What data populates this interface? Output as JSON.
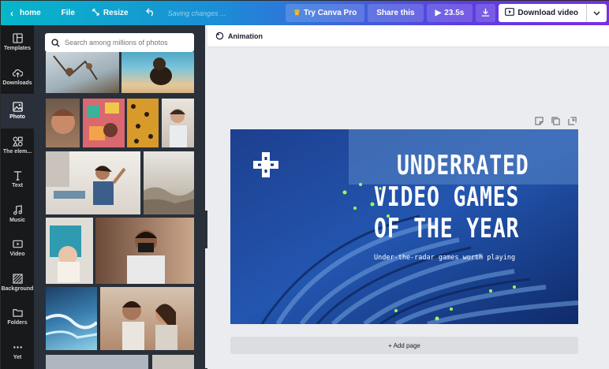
{
  "topbar": {
    "home_label": "home",
    "file_label": "File",
    "resize_label": "Resize",
    "saving_label": "Saving changes ...",
    "try_pro_label": "Try Canva Pro",
    "share_label": "Share this",
    "duration_label": "23.5s",
    "download_label": "Download video"
  },
  "rail": {
    "items": [
      {
        "label": "Templates",
        "icon": "templates-icon"
      },
      {
        "label": "Downloads",
        "icon": "upload-cloud-icon"
      },
      {
        "label": "Photo",
        "icon": "photo-icon"
      },
      {
        "label": "The elem...",
        "icon": "elements-icon"
      },
      {
        "label": "Text",
        "icon": "text-icon"
      },
      {
        "label": "Music",
        "icon": "music-icon"
      },
      {
        "label": "Video",
        "icon": "video-icon"
      },
      {
        "label": "Background",
        "icon": "background-icon"
      },
      {
        "label": "Folders",
        "icon": "folder-icon"
      },
      {
        "label": "Yet",
        "icon": "more-icon"
      }
    ],
    "active": "Photo"
  },
  "panel": {
    "search_placeholder": "Search among millions of photos"
  },
  "editor": {
    "animation_label": "Animation",
    "add_page_label": "+ Add page"
  },
  "design": {
    "title_line1": "UNDERRATED",
    "title_line2": "VIDEO GAMES",
    "title_line3": "OF THE YEAR",
    "subtitle": "Under-the-radar games worth playing"
  },
  "colors": {
    "accent_start": "#06b6c9",
    "accent_end": "#7a2ee6",
    "panel_bg": "#293039",
    "rail_bg": "#18191b",
    "design_bg": "#16327a"
  }
}
